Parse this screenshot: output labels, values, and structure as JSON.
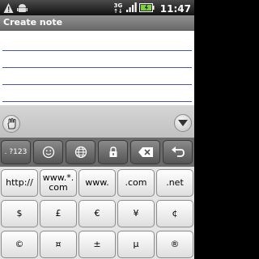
{
  "status_bar": {
    "network_top": "3G",
    "network_bottom": "↑↓",
    "time": "11:47"
  },
  "title_bar": {
    "title": "Create note"
  },
  "function_row": {
    "numbers_label": ". ?123",
    "emoji_icon": "smiley-icon",
    "globe_icon": "globe-icon",
    "lock_icon": "lock-icon",
    "delete_icon": "backspace-icon",
    "undo_icon": "undo-icon"
  },
  "keyboard_rows": [
    [
      "http://",
      "www.*.\ncom",
      "www.",
      ".com",
      ".net"
    ],
    [
      "$",
      "£",
      "€",
      "¥",
      "¢"
    ],
    [
      "©",
      "¤",
      "±",
      "µ",
      "®"
    ]
  ],
  "colors": {
    "note_line": "#4c55a8",
    "title_bar": "#7d7d7d",
    "function_row": "#6b6b6b"
  }
}
